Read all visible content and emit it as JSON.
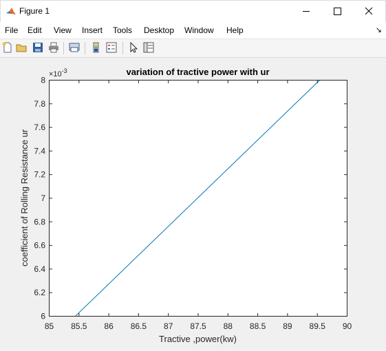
{
  "window": {
    "title": "Figure 1",
    "controls": {
      "minimize": "minimize",
      "maximize": "maximize",
      "close": "close"
    }
  },
  "menu": {
    "items": [
      "File",
      "Edit",
      "View",
      "Insert",
      "Tools",
      "Desktop",
      "Window",
      "Help"
    ]
  },
  "toolbar": {
    "buttons": [
      "new-figure-icon",
      "open-file-icon",
      "save-icon",
      "print-icon",
      "print-preview-icon",
      "colorbar-icon",
      "legend-icon",
      "edit-plot-pointer-icon",
      "property-inspector-icon"
    ]
  },
  "chart_data": {
    "type": "line",
    "title": "variation of tractive power with ur",
    "xlabel": "Tractive ,power(kw)",
    "ylabel": "coefficient of Rolling Resistance ur",
    "y_exponent_label": "×10",
    "y_exponent": "-3",
    "xlim": [
      85,
      90
    ],
    "ylim": [
      6,
      8
    ],
    "x_ticks": [
      "85",
      "85.5",
      "86",
      "86.5",
      "87",
      "87.5",
      "88",
      "88.5",
      "89",
      "89.5",
      "90"
    ],
    "y_ticks": [
      "6",
      "6.2",
      "6.4",
      "6.6",
      "6.8",
      "7",
      "7.2",
      "7.4",
      "7.6",
      "7.8",
      "8"
    ],
    "series": [
      {
        "x": [
          85.45,
          89.55
        ],
        "y": [
          6.0,
          8.0
        ],
        "color": "#0072bd"
      }
    ],
    "grid": false,
    "box": true
  }
}
